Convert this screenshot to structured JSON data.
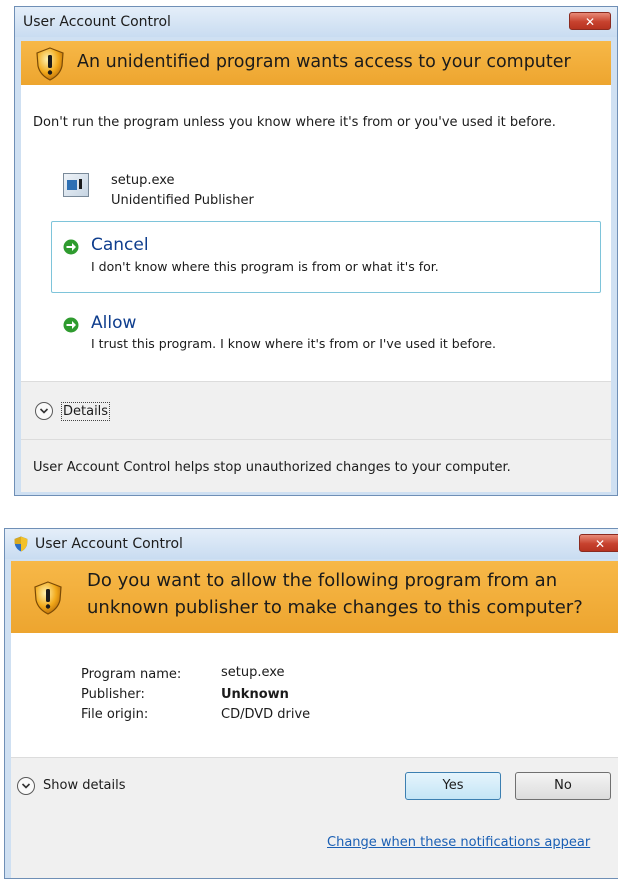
{
  "dialog1": {
    "title": "User Account Control",
    "close_label": "✕",
    "banner_text": "An unidentified program wants access to your computer",
    "warning": "Don't run the program unless you know where it's from or you've used it before.",
    "program_name": "setup.exe",
    "publisher": "Unidentified Publisher",
    "cancel_title": "Cancel",
    "cancel_desc": "I don't know where this program is from or what it's for.",
    "allow_title": "Allow",
    "allow_desc": "I trust this program. I know where it's from or I've used it before.",
    "details_label": "Details",
    "footer_text": "User Account Control helps stop unauthorized changes to your computer."
  },
  "dialog2": {
    "title": "User Account Control",
    "close_label": "✕",
    "banner_line1": "Do you want to allow the following program from an",
    "banner_line2": "unknown publisher to make changes to this computer?",
    "fields": [
      {
        "label": "Program name:",
        "value": "setup.exe"
      },
      {
        "label": "Publisher:",
        "value": "Unknown"
      },
      {
        "label": "File origin:",
        "value": "CD/DVD drive"
      }
    ],
    "show_details_label": "Show details",
    "yes_label": "Yes",
    "no_label": "No",
    "change_link": "Change when these notifications appear"
  },
  "colors": {
    "banner": "#eda52f",
    "link": "#1a5fb4",
    "command_title": "#0e3d8d",
    "command_border": "#7ec4da"
  },
  "icons": [
    "shield-warning-icon",
    "program-icon",
    "green-arrow-icon",
    "chevron-down-icon",
    "close-icon"
  ]
}
